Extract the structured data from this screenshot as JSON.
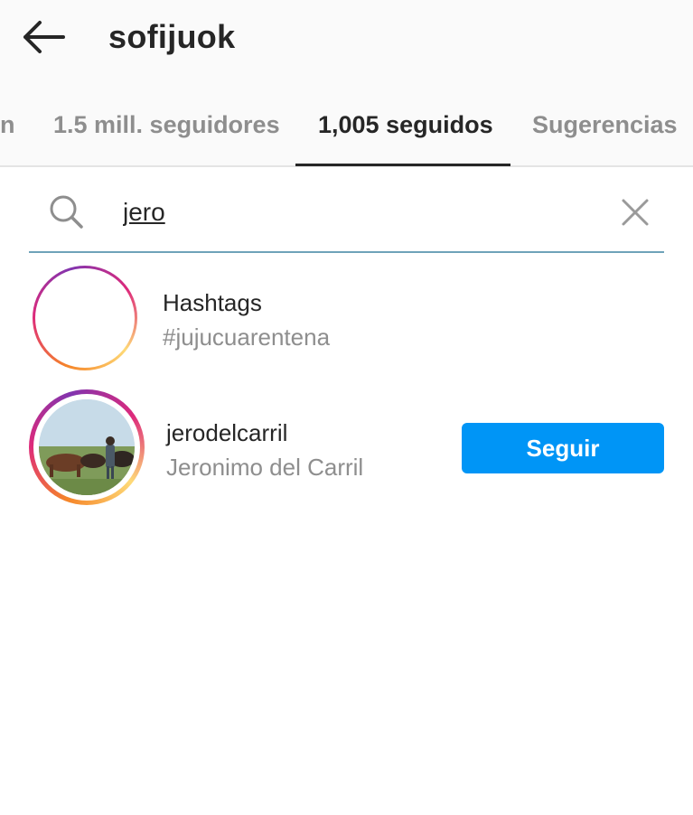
{
  "header": {
    "title": "sofijuok",
    "back_icon": "arrow-left-icon"
  },
  "tabs": [
    {
      "label": "n"
    },
    {
      "label": "1.5 mill. seguidores"
    },
    {
      "label": "1,005 seguidos",
      "active": true
    },
    {
      "label": "Sugerencias"
    }
  ],
  "search": {
    "value": "jero",
    "icon": "search-icon",
    "clear_icon": "close-icon",
    "accent_color": "#6fa3b9"
  },
  "results": [
    {
      "type": "hashtags",
      "title": "Hashtags",
      "subtitle": "#jujucuarentena",
      "icon": "hashtag-icon"
    },
    {
      "type": "user",
      "username": "jerodelcarril",
      "full_name": "Jeronimo del Carril",
      "button": "Seguir"
    }
  ],
  "colors": {
    "follow_button": "#0095f6",
    "text": "#262626",
    "muted": "#8e8e8e"
  }
}
